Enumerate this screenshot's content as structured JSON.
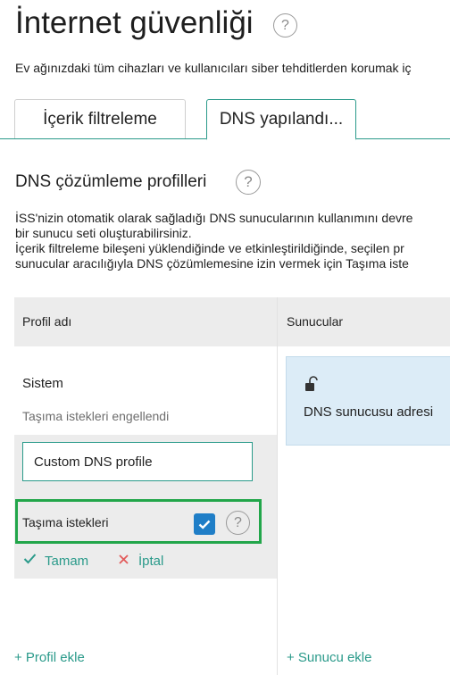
{
  "page": {
    "title": "İnternet güvenliği",
    "description": "Ev ağınızdaki tüm cihazları ve kullanıcıları siber tehditlerden korumak iç"
  },
  "tabs": [
    {
      "label": "İçerik filtreleme"
    },
    {
      "label": "DNS yapılandı..."
    }
  ],
  "section": {
    "title": "DNS çözümleme profilleri",
    "paragraph_lines": [
      "İSS'nizin otomatik olarak sağladığı DNS sunucularının kullanımını devre",
      "bir sunucu seti oluşturabilirsiniz.",
      "İçerik filtreleme bileşeni yüklendiğinde ve etkinleştirildiğinde, seçilen pr",
      "sunucular aracılığıyla DNS çözümlemesine izin vermek için Taşıma iste"
    ]
  },
  "table": {
    "headers": {
      "profile": "Profil adı",
      "servers": "Sunucular"
    },
    "system_row": {
      "name": "Sistem",
      "subtitle": "Taşıma istekleri engellendi"
    },
    "edit_row": {
      "name_value": "Custom DNS profile",
      "redirect_label": "Taşıma istekleri",
      "redirect_checked": true,
      "ok_label": "Tamam",
      "cancel_label": "İptal"
    },
    "server_card": {
      "label": "DNS sunucusu adresi"
    }
  },
  "footer": {
    "add_profile": "+ Profil ekle",
    "add_server": "+ Sunucu ekle"
  },
  "icons": {
    "help": "question-mark-circle-icon",
    "check": "checkmark-icon",
    "close": "x-icon",
    "lock": "unlocked-padlock-icon"
  },
  "colors": {
    "accent": "#2a9a8a",
    "checkbox": "#1f7ec7",
    "highlight_border": "#22a64a",
    "cancel": "#e25a5a",
    "server_card": "#dcecf7"
  }
}
